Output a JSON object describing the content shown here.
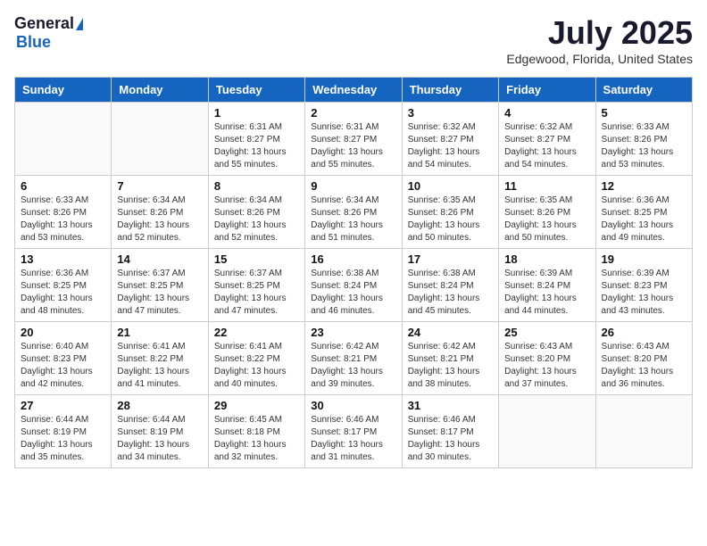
{
  "logo": {
    "general": "General",
    "blue": "Blue"
  },
  "title": "July 2025",
  "location": "Edgewood, Florida, United States",
  "days_of_week": [
    "Sunday",
    "Monday",
    "Tuesday",
    "Wednesday",
    "Thursday",
    "Friday",
    "Saturday"
  ],
  "weeks": [
    [
      {
        "day": "",
        "info": ""
      },
      {
        "day": "",
        "info": ""
      },
      {
        "day": "1",
        "info": "Sunrise: 6:31 AM\nSunset: 8:27 PM\nDaylight: 13 hours and 55 minutes."
      },
      {
        "day": "2",
        "info": "Sunrise: 6:31 AM\nSunset: 8:27 PM\nDaylight: 13 hours and 55 minutes."
      },
      {
        "day": "3",
        "info": "Sunrise: 6:32 AM\nSunset: 8:27 PM\nDaylight: 13 hours and 54 minutes."
      },
      {
        "day": "4",
        "info": "Sunrise: 6:32 AM\nSunset: 8:27 PM\nDaylight: 13 hours and 54 minutes."
      },
      {
        "day": "5",
        "info": "Sunrise: 6:33 AM\nSunset: 8:26 PM\nDaylight: 13 hours and 53 minutes."
      }
    ],
    [
      {
        "day": "6",
        "info": "Sunrise: 6:33 AM\nSunset: 8:26 PM\nDaylight: 13 hours and 53 minutes."
      },
      {
        "day": "7",
        "info": "Sunrise: 6:34 AM\nSunset: 8:26 PM\nDaylight: 13 hours and 52 minutes."
      },
      {
        "day": "8",
        "info": "Sunrise: 6:34 AM\nSunset: 8:26 PM\nDaylight: 13 hours and 52 minutes."
      },
      {
        "day": "9",
        "info": "Sunrise: 6:34 AM\nSunset: 8:26 PM\nDaylight: 13 hours and 51 minutes."
      },
      {
        "day": "10",
        "info": "Sunrise: 6:35 AM\nSunset: 8:26 PM\nDaylight: 13 hours and 50 minutes."
      },
      {
        "day": "11",
        "info": "Sunrise: 6:35 AM\nSunset: 8:26 PM\nDaylight: 13 hours and 50 minutes."
      },
      {
        "day": "12",
        "info": "Sunrise: 6:36 AM\nSunset: 8:25 PM\nDaylight: 13 hours and 49 minutes."
      }
    ],
    [
      {
        "day": "13",
        "info": "Sunrise: 6:36 AM\nSunset: 8:25 PM\nDaylight: 13 hours and 48 minutes."
      },
      {
        "day": "14",
        "info": "Sunrise: 6:37 AM\nSunset: 8:25 PM\nDaylight: 13 hours and 47 minutes."
      },
      {
        "day": "15",
        "info": "Sunrise: 6:37 AM\nSunset: 8:25 PM\nDaylight: 13 hours and 47 minutes."
      },
      {
        "day": "16",
        "info": "Sunrise: 6:38 AM\nSunset: 8:24 PM\nDaylight: 13 hours and 46 minutes."
      },
      {
        "day": "17",
        "info": "Sunrise: 6:38 AM\nSunset: 8:24 PM\nDaylight: 13 hours and 45 minutes."
      },
      {
        "day": "18",
        "info": "Sunrise: 6:39 AM\nSunset: 8:24 PM\nDaylight: 13 hours and 44 minutes."
      },
      {
        "day": "19",
        "info": "Sunrise: 6:39 AM\nSunset: 8:23 PM\nDaylight: 13 hours and 43 minutes."
      }
    ],
    [
      {
        "day": "20",
        "info": "Sunrise: 6:40 AM\nSunset: 8:23 PM\nDaylight: 13 hours and 42 minutes."
      },
      {
        "day": "21",
        "info": "Sunrise: 6:41 AM\nSunset: 8:22 PM\nDaylight: 13 hours and 41 minutes."
      },
      {
        "day": "22",
        "info": "Sunrise: 6:41 AM\nSunset: 8:22 PM\nDaylight: 13 hours and 40 minutes."
      },
      {
        "day": "23",
        "info": "Sunrise: 6:42 AM\nSunset: 8:21 PM\nDaylight: 13 hours and 39 minutes."
      },
      {
        "day": "24",
        "info": "Sunrise: 6:42 AM\nSunset: 8:21 PM\nDaylight: 13 hours and 38 minutes."
      },
      {
        "day": "25",
        "info": "Sunrise: 6:43 AM\nSunset: 8:20 PM\nDaylight: 13 hours and 37 minutes."
      },
      {
        "day": "26",
        "info": "Sunrise: 6:43 AM\nSunset: 8:20 PM\nDaylight: 13 hours and 36 minutes."
      }
    ],
    [
      {
        "day": "27",
        "info": "Sunrise: 6:44 AM\nSunset: 8:19 PM\nDaylight: 13 hours and 35 minutes."
      },
      {
        "day": "28",
        "info": "Sunrise: 6:44 AM\nSunset: 8:19 PM\nDaylight: 13 hours and 34 minutes."
      },
      {
        "day": "29",
        "info": "Sunrise: 6:45 AM\nSunset: 8:18 PM\nDaylight: 13 hours and 32 minutes."
      },
      {
        "day": "30",
        "info": "Sunrise: 6:46 AM\nSunset: 8:17 PM\nDaylight: 13 hours and 31 minutes."
      },
      {
        "day": "31",
        "info": "Sunrise: 6:46 AM\nSunset: 8:17 PM\nDaylight: 13 hours and 30 minutes."
      },
      {
        "day": "",
        "info": ""
      },
      {
        "day": "",
        "info": ""
      }
    ]
  ]
}
